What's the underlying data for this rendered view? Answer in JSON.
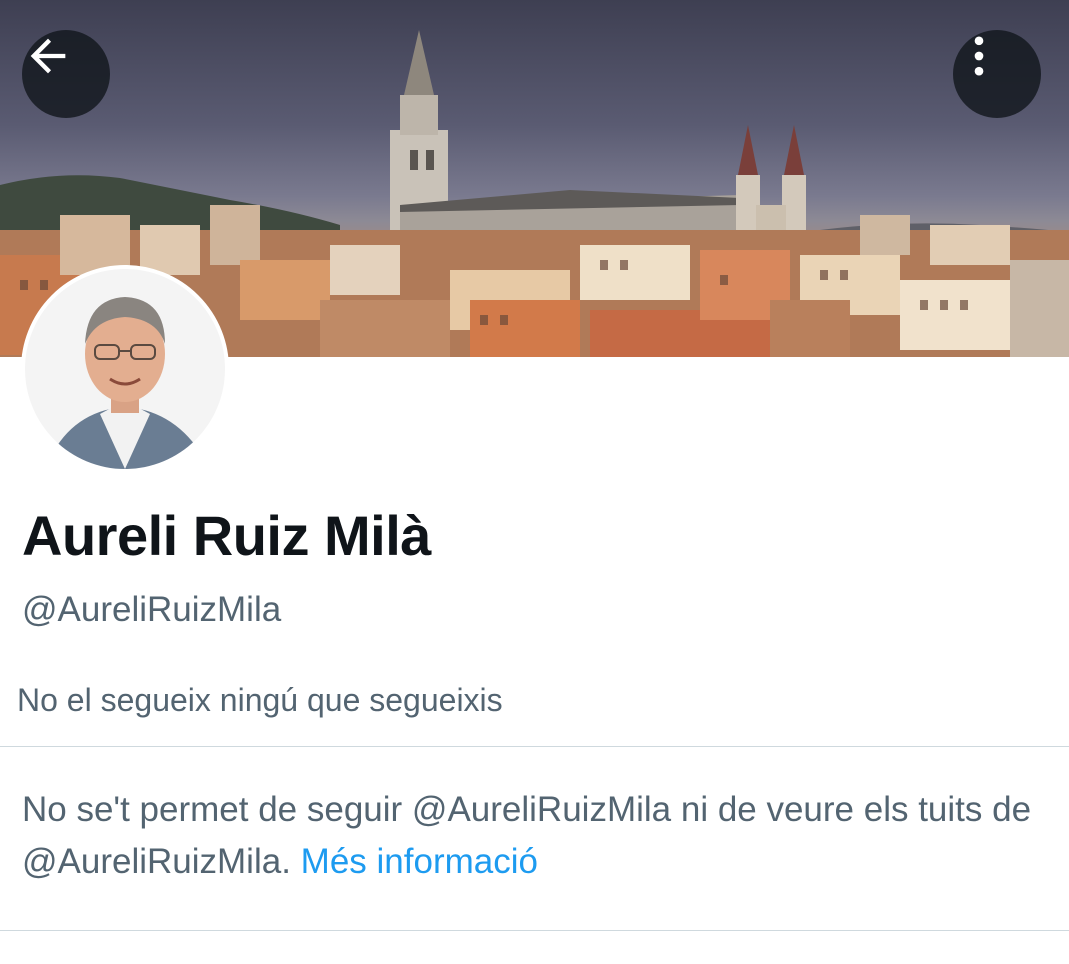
{
  "header": {
    "back_icon": "arrow-left-icon",
    "more_icon": "more-vertical-icon"
  },
  "banner": {
    "description_icon": "city-skyline-banner"
  },
  "profile": {
    "display_name": "Aureli Ruiz Milà",
    "handle": "@AureliRuizMila",
    "followers_note": "No el segueix ningú que segueixis"
  },
  "blocked": {
    "message": "No se't permet de seguir @AureliRuizMila ni de veure els tuits de @AureliRuizMila.",
    "link_label": "Més informació"
  },
  "colors": {
    "text_primary": "#0f1419",
    "text_secondary": "#536471",
    "link": "#1d9bf0",
    "divider": "#cfd9de"
  }
}
